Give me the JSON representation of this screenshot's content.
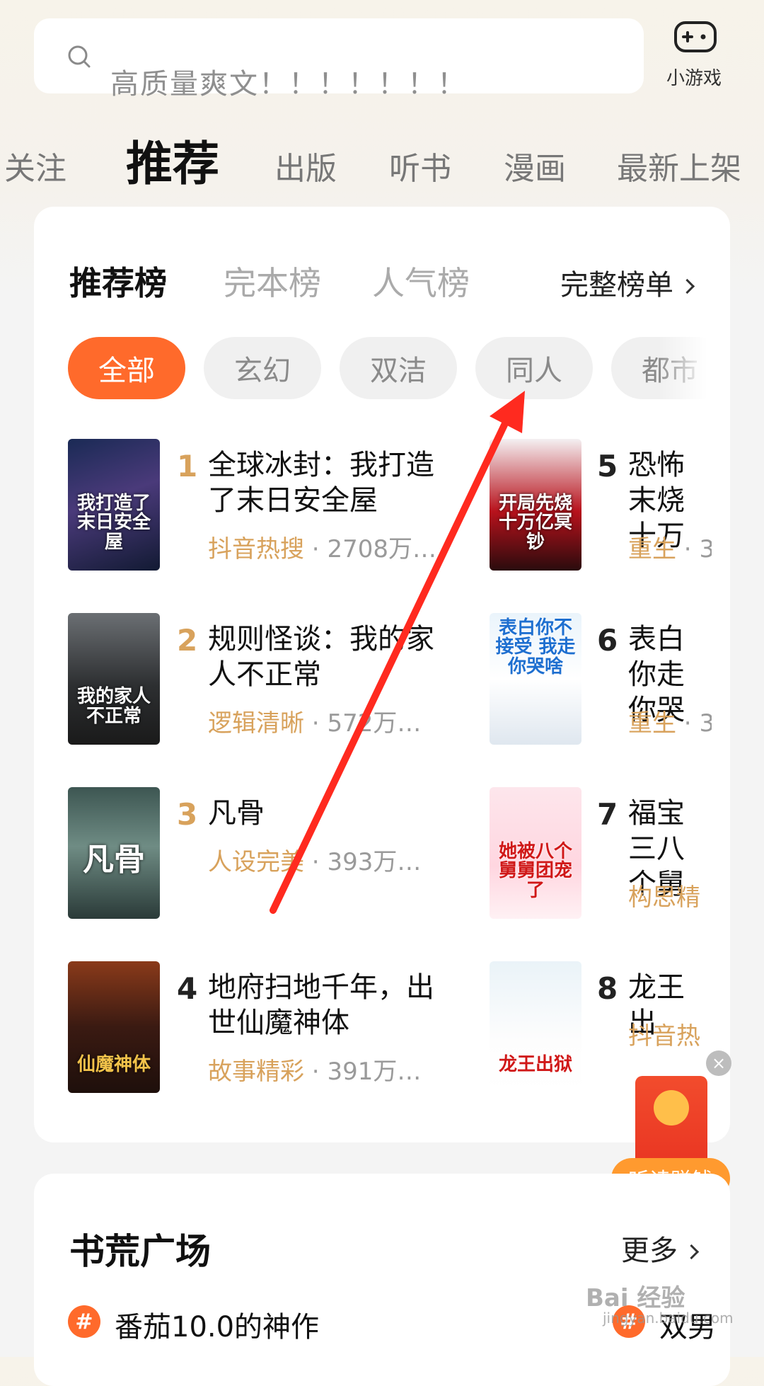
{
  "search": {
    "placeholder_text": "高质量爽文！！！！！！！",
    "icon": "search-icon"
  },
  "top_right": {
    "label": "小游戏",
    "icon": "gamepad-icon"
  },
  "tabs": [
    "关注",
    "推荐",
    "出版",
    "听书",
    "漫画",
    "最新上架"
  ],
  "ranking": {
    "tabs": [
      "推荐榜",
      "完本榜",
      "人气榜"
    ],
    "full_list_label": "完整榜单",
    "chips": [
      "全部",
      "玄幻",
      "双洁",
      "同人",
      "都市"
    ],
    "left_books": [
      {
        "rank": "1",
        "title": "全球冰封：我打造了末日安全屋",
        "tag": "抖音热搜",
        "count": "2708万…",
        "cover_text": "我打造了末日安全屋"
      },
      {
        "rank": "2",
        "title": "规则怪谈：我的家人不正常",
        "tag": "逻辑清晰",
        "count": "572万…",
        "cover_text": "我的家人不正常"
      },
      {
        "rank": "3",
        "title": "凡骨",
        "tag": "人设完美",
        "count": "393万…",
        "cover_text": "凡骨"
      },
      {
        "rank": "4",
        "title": "地府扫地千年，出世仙魔神体",
        "tag": "故事精彩",
        "count": "391万…",
        "cover_text": "仙魔神体"
      }
    ],
    "right_books": [
      {
        "rank": "5",
        "title": "恐怖末烧十万",
        "tag": "重生",
        "count": "3",
        "cover_text": "开局先烧十万亿冥钞"
      },
      {
        "rank": "6",
        "title": "表白你走你哭",
        "tag": "重生",
        "count": "3",
        "cover_text": "表白你不接受 我走你哭啥"
      },
      {
        "rank": "7",
        "title": "福宝三八个舅",
        "tag": "构思精",
        "count": "",
        "cover_text": "她被八个舅舅团宠了"
      },
      {
        "rank": "8",
        "title": "龙王出",
        "tag": "抖音热",
        "count": "",
        "cover_text": "龙王出狱"
      }
    ]
  },
  "float_reward": {
    "label": "听读赚钱",
    "close": "×"
  },
  "square": {
    "title": "书荒广场",
    "more_label": "更多",
    "topics": [
      {
        "label": "番茄10.0的神作"
      },
      {
        "label": "双男"
      }
    ]
  },
  "watermark": {
    "main": "Bai 经验",
    "sub": "jingyan.baidu.com"
  },
  "colors": {
    "accent": "#ff6a2b",
    "tag_gold": "#d8a25c",
    "arrow": "#ff2a1f",
    "reward_orange": "#ff9a2f"
  }
}
